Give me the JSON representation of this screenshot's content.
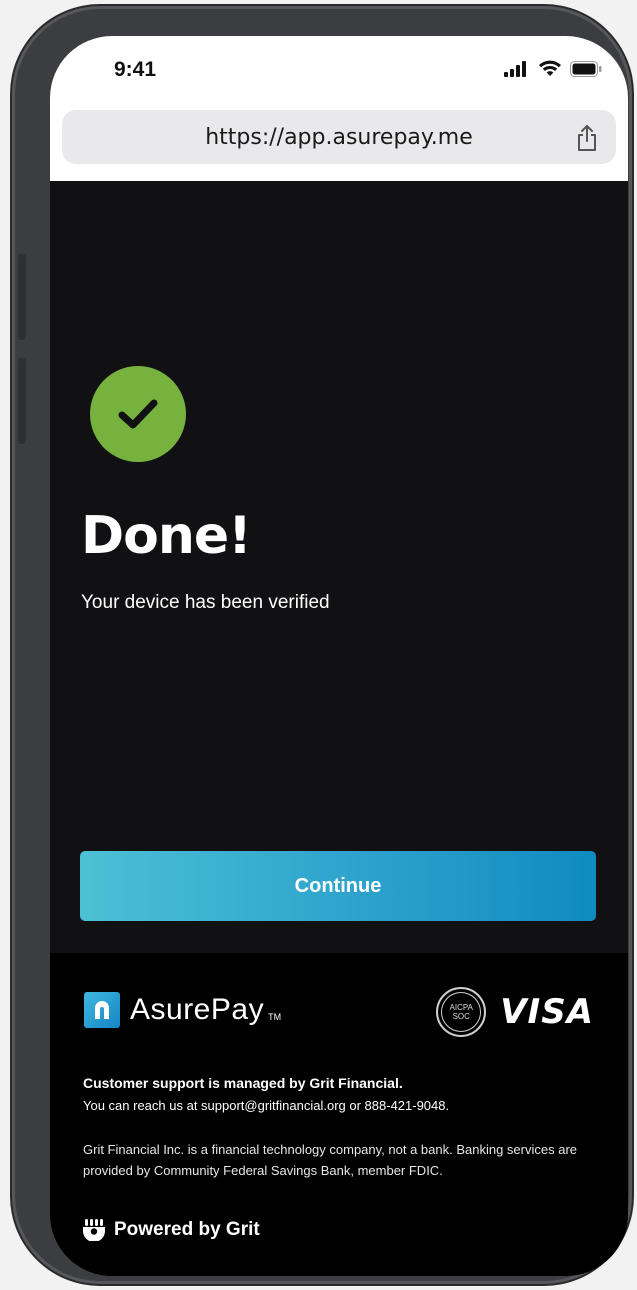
{
  "status_bar": {
    "time": "9:41"
  },
  "browser": {
    "url": "https://app.asurepay.me"
  },
  "main": {
    "title": "Done!",
    "subtitle": "Your device has been verified",
    "continue_label": "Continue",
    "accent_color": "#77b13e"
  },
  "footer": {
    "brand_name": "AsurePay",
    "brand_tm": "TM",
    "soc_badge_lines": [
      "AICPA",
      "SOC"
    ],
    "visa_label": "VISA",
    "support_title": "Customer support is managed by Grit Financial.",
    "support_text": "You can reach us at support@gritfinancial.org or 888-421-9048.",
    "disclaimer": "Grit Financial Inc. is a financial technology company, not a bank. Banking services are provided by Community Federal Savings Bank, member FDIC.",
    "powered_by": "Powered by Grit"
  }
}
